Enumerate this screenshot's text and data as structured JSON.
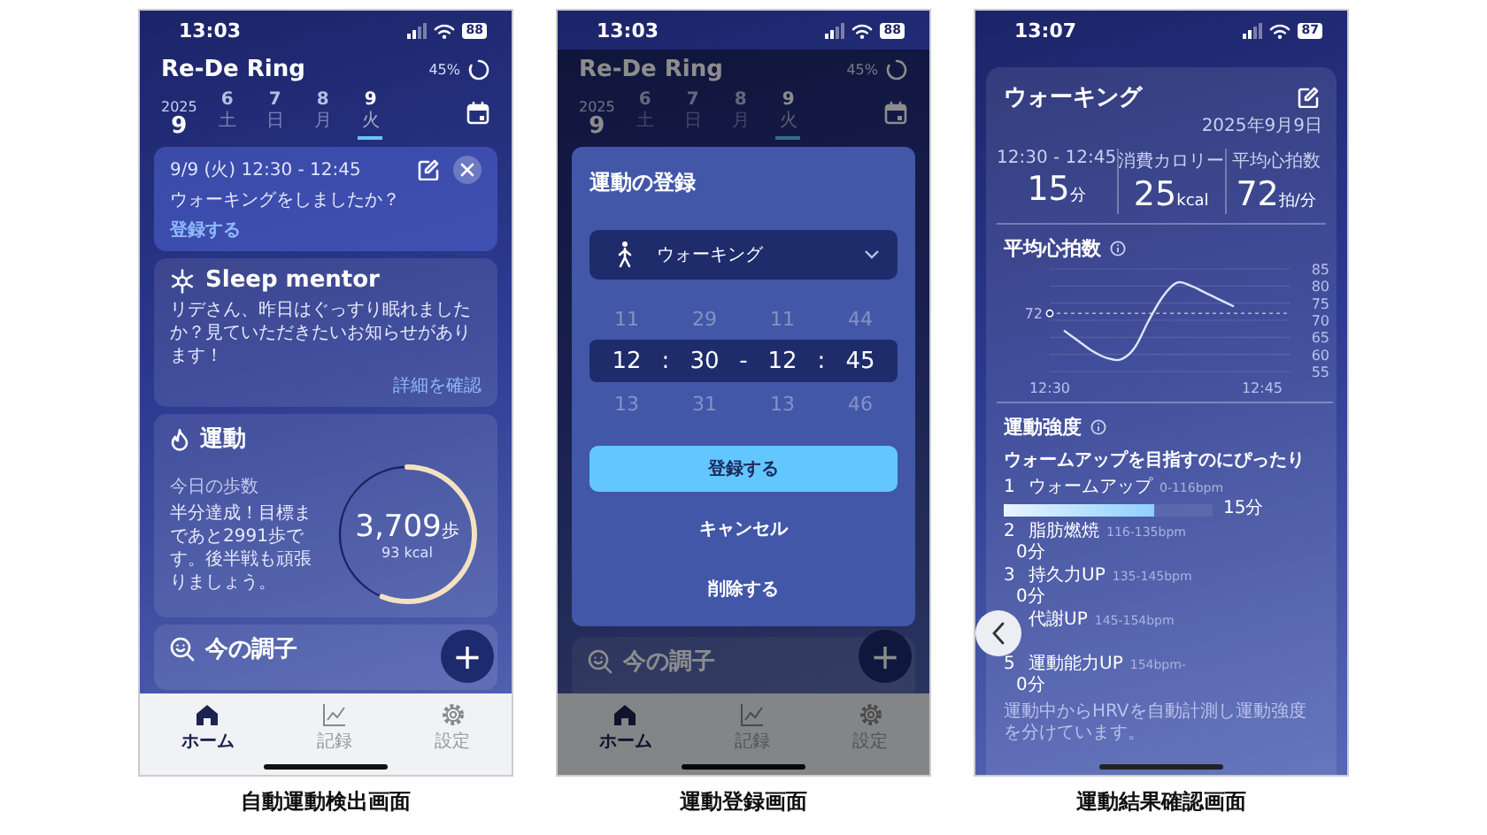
{
  "screens": [
    {
      "kind": "home",
      "caption": "自動運動検出画面",
      "status": {
        "time": "13:03",
        "battery": "88"
      },
      "header": {
        "app_title": "Re-De Ring",
        "sync": "45%"
      },
      "dates": {
        "year": "2025",
        "month": "9",
        "days": [
          {
            "day": "6",
            "weekday": "土",
            "selected": false
          },
          {
            "day": "7",
            "weekday": "日",
            "selected": false
          },
          {
            "day": "8",
            "weekday": "月",
            "selected": false
          },
          {
            "day": "9",
            "weekday": "火",
            "selected": true
          }
        ]
      },
      "detection": {
        "time": "9/9 (火) 12:30 - 12:45",
        "question": "ウォーキングをしましたか？",
        "link": "登録する"
      },
      "sleep": {
        "title": "Sleep mentor",
        "text": "リデさん、昨日はぐっすり眠れましたか？見ていただきたいお知らせがあります！",
        "link": "詳細を確認"
      },
      "exercise": {
        "title": "運動",
        "subtitle": "今日の歩数",
        "text": "半分達成！目標まであと2991歩です。後半戦も頑張りましょう。",
        "steps": "3,709",
        "unit": "歩",
        "kcal": "93 kcal",
        "level": 0.56
      },
      "condition": {
        "title": "今の調子"
      },
      "fab": "+",
      "nav": [
        {
          "label": "ホーム",
          "selected": true
        },
        {
          "label": "記録",
          "selected": false
        },
        {
          "label": "設定",
          "selected": false
        }
      ]
    },
    {
      "kind": "register",
      "caption": "運動登録画面",
      "status": {
        "time": "13:03",
        "battery": "88"
      },
      "header": {
        "app_title": "Re-De Ring",
        "sync": "45%"
      },
      "dates": {
        "year": "2025",
        "month": "9",
        "days": [
          {
            "day": "6",
            "weekday": "土",
            "selected": false
          },
          {
            "day": "7",
            "weekday": "日",
            "selected": false
          },
          {
            "day": "8",
            "weekday": "月",
            "selected": false
          },
          {
            "day": "9",
            "weekday": "火",
            "selected": true
          }
        ]
      },
      "modal": {
        "title": "運動の登録",
        "activity": "ウォーキング",
        "picker": {
          "columns": [
            {
              "above": "11",
              "value": "12",
              "below": "13"
            },
            {
              "above": "29",
              "value": "30",
              "below": "31"
            },
            {
              "above": "11",
              "value": "12",
              "below": "13"
            },
            {
              "above": "44",
              "value": "45",
              "below": "46"
            }
          ],
          "separators": [
            ":",
            "-",
            ":"
          ]
        },
        "buttons": [
          {
            "label": "登録する",
            "kind": "primary"
          },
          {
            "label": "キャンセル",
            "kind": "text"
          },
          {
            "label": "削除する",
            "kind": "text"
          }
        ]
      },
      "condition": {
        "title": "今の調子"
      },
      "fab": "+",
      "nav": [
        {
          "label": "ホーム",
          "selected": true
        },
        {
          "label": "記録",
          "selected": false
        },
        {
          "label": "設定",
          "selected": false
        }
      ]
    },
    {
      "kind": "result",
      "caption": "運動結果確認画面",
      "status": {
        "time": "13:07",
        "battery": "87"
      },
      "result": {
        "title": "ウォーキング",
        "date": "2025年9月9日",
        "stats": [
          {
            "label": "12:30 - 12:45",
            "value": "15",
            "unit": "分"
          },
          {
            "label": "消費カロリー",
            "value": "25",
            "unit": "kcal"
          },
          {
            "label": "平均心拍数",
            "value": "72",
            "unit": "拍/分"
          }
        ],
        "chart_data": {
          "type": "line",
          "title": "平均心拍数",
          "categories": [
            "12:30",
            null,
            null,
            null,
            null,
            null,
            null,
            null,
            null,
            null,
            null,
            null,
            null,
            null,
            null,
            "12:45"
          ],
          "series": [
            {
              "color": "#dfe6ff",
              "values": [
                null,
                67,
                64,
                61,
                59,
                58.5,
                62,
                70,
                77,
                81,
                80,
                78,
                76,
                74,
                null,
                null
              ]
            }
          ],
          "ylim": [
            55,
            85
          ],
          "yticks": [
            55,
            60,
            65,
            70,
            75,
            80,
            85
          ],
          "grid": true,
          "ref_lines": [
            {
              "axis": "y",
              "value": 72,
              "label": "72"
            }
          ]
        },
        "intensity_title": "運動強度",
        "headline": "ウォームアップを目指すのにぴったり",
        "zones": [
          {
            "number": "1",
            "name": "ウォームアップ",
            "range": "0-116bpm",
            "time": "15分",
            "level": 0.72
          },
          {
            "number": "2",
            "name": "脂肪燃焼",
            "range": "116-135bpm",
            "time": "0分"
          },
          {
            "number": "3",
            "name": "持久力UP",
            "range": "135-145bpm",
            "time": "0分"
          },
          {
            "name": "代謝UP",
            "range": "145-154bpm"
          },
          {
            "number": "5",
            "name": "運動能力UP",
            "range": "154bpm-",
            "time": "0分"
          }
        ],
        "footnote": "運動中からHRVを自動計測し運動強度を分けています。"
      }
    }
  ]
}
